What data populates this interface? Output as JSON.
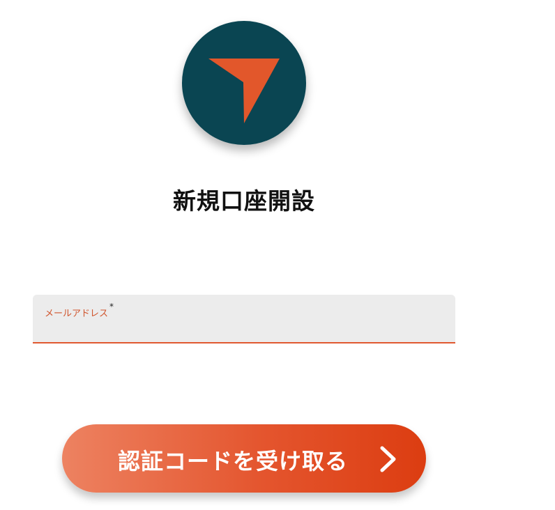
{
  "logo": {
    "icon": "navigation-arrow-icon",
    "circle_color": "#0a4552",
    "arrow_color": "#e2572b"
  },
  "page_title": "新規口座開設",
  "email_field": {
    "label": "メールアドレス",
    "required_mark": "*",
    "value": "",
    "placeholder": ""
  },
  "submit_button": {
    "label": "認証コードを受け取る",
    "icon": "chevron-right-icon"
  },
  "colors": {
    "accent": "#e0582f",
    "field_background": "#ececec",
    "button_gradient_start": "#ed8261",
    "button_gradient_end": "#dc3d11"
  }
}
